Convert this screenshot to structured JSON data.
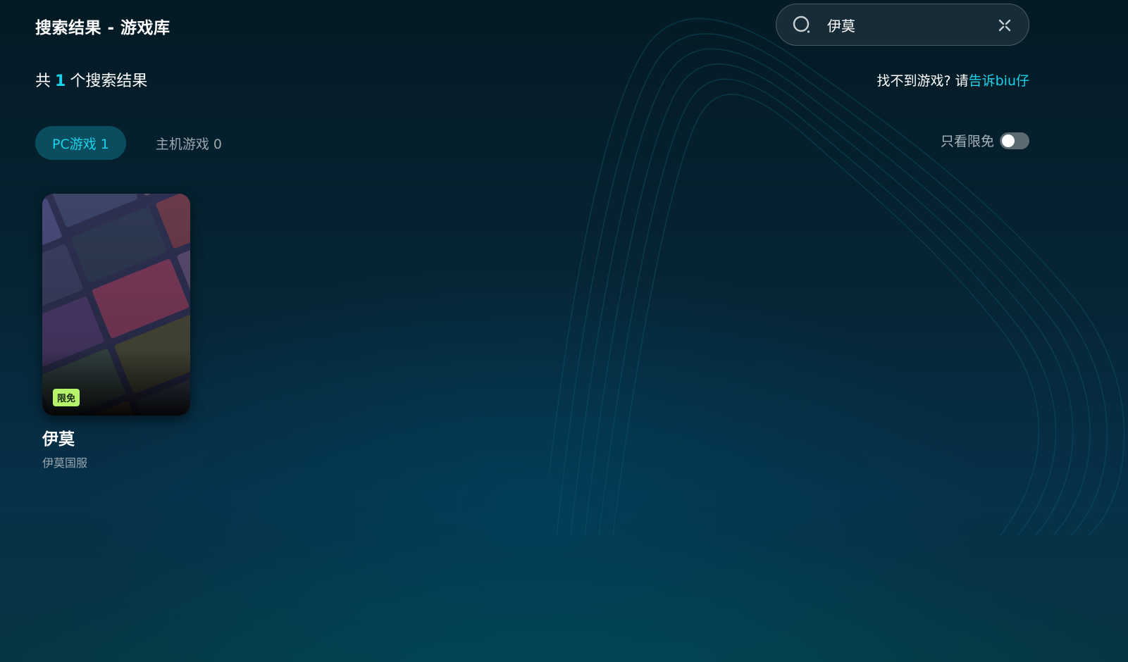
{
  "header": {
    "title": "搜索结果 - 游戏库"
  },
  "search": {
    "value": "伊莫",
    "icon": "search-icon",
    "clear_icon": "close-icon"
  },
  "results": {
    "prefix": "共",
    "count": "1",
    "suffix": "个搜索结果"
  },
  "feedback": {
    "text": "找不到游戏? 请",
    "link": "告诉biu仔"
  },
  "tabs": [
    {
      "label": "PC游戏 1",
      "active": true
    },
    {
      "label": "主机游戏 0",
      "active": false
    }
  ],
  "filter": {
    "label": "只看限免",
    "enabled": false
  },
  "games": [
    {
      "name": "伊莫",
      "subtitle": "伊莫国服",
      "badge": "限免"
    }
  ],
  "colors": {
    "accent": "#19d3ea",
    "badge": "#b5f36a",
    "tab_active_bg": "#0a4d5e"
  }
}
